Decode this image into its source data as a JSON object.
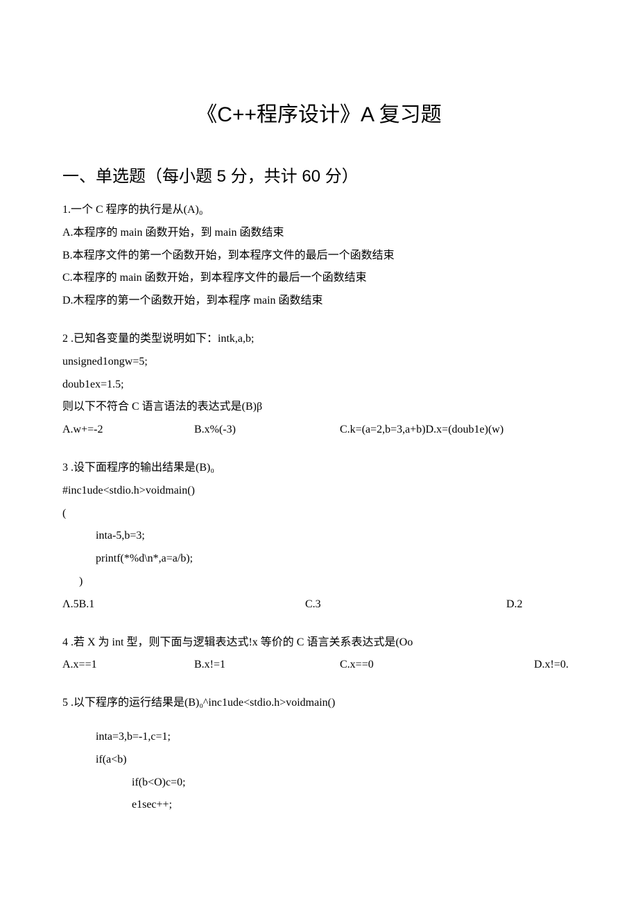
{
  "title": "《C++程序设计》A 复习题",
  "section1_heading": "一、单选题（每小题 5 分，共计 60 分）",
  "q1": {
    "stem": "1.一个 C 程序的执行是从(A)₀",
    "a": "A.本程序的 main 函数开始，到 main 函数结束",
    "b": "B.本程序文件的第一个函数开始，到本程序文件的最后一个函数结束",
    "c": "C.本程序的 main 函数开始，到本程序文件的最后一个函数结束",
    "d": "D.木程序的第一个函数开始，到本程序 main 函数结束"
  },
  "q2": {
    "stem": "2  .已知各变量的类型说明如下：intk,a,b;",
    "line2": "unsigned1ongw=5;",
    "line3": "doub1ex=1.5;",
    "line4": "则以下不符合 C 语言语法的表达式是(B)β",
    "optA": "A.w+=-2",
    "optB": "B.x%(-3)",
    "optC": "C.k=(a=2,b=3,a+b)D.x=(doub1e)(w)"
  },
  "q3": {
    "stem": "3  .设下面程序的输出结果是(B)₀",
    "c1": "#inc1ude<stdio.h>voidmain()",
    "c2": "(",
    "c3": "inta-5,b=3;",
    "c4": "printf(*%d\\n*,a=a/b);",
    "c5": ")",
    "optA": "Λ.5B.1",
    "optC": "C.3",
    "optD": "D.2"
  },
  "q4": {
    "stem": "4  .若 X 为 int 型，则下面与逻辑表达式!x 等价的 C 语言关系表达式是(Oo",
    "optA": "A.x==1",
    "optB": "B.x!=1",
    "optC": "C.x==0",
    "optD": "D.x!=0."
  },
  "q5": {
    "stem": "5  .以下程序的运行结果是(B)₀^inc1ude<stdio.h>voidmain()",
    "c1": "inta=3,b=-1,c=1;",
    "c2": "if(a<b)",
    "c3": "if(b<O)c=0;",
    "c4": "e1sec++;"
  }
}
